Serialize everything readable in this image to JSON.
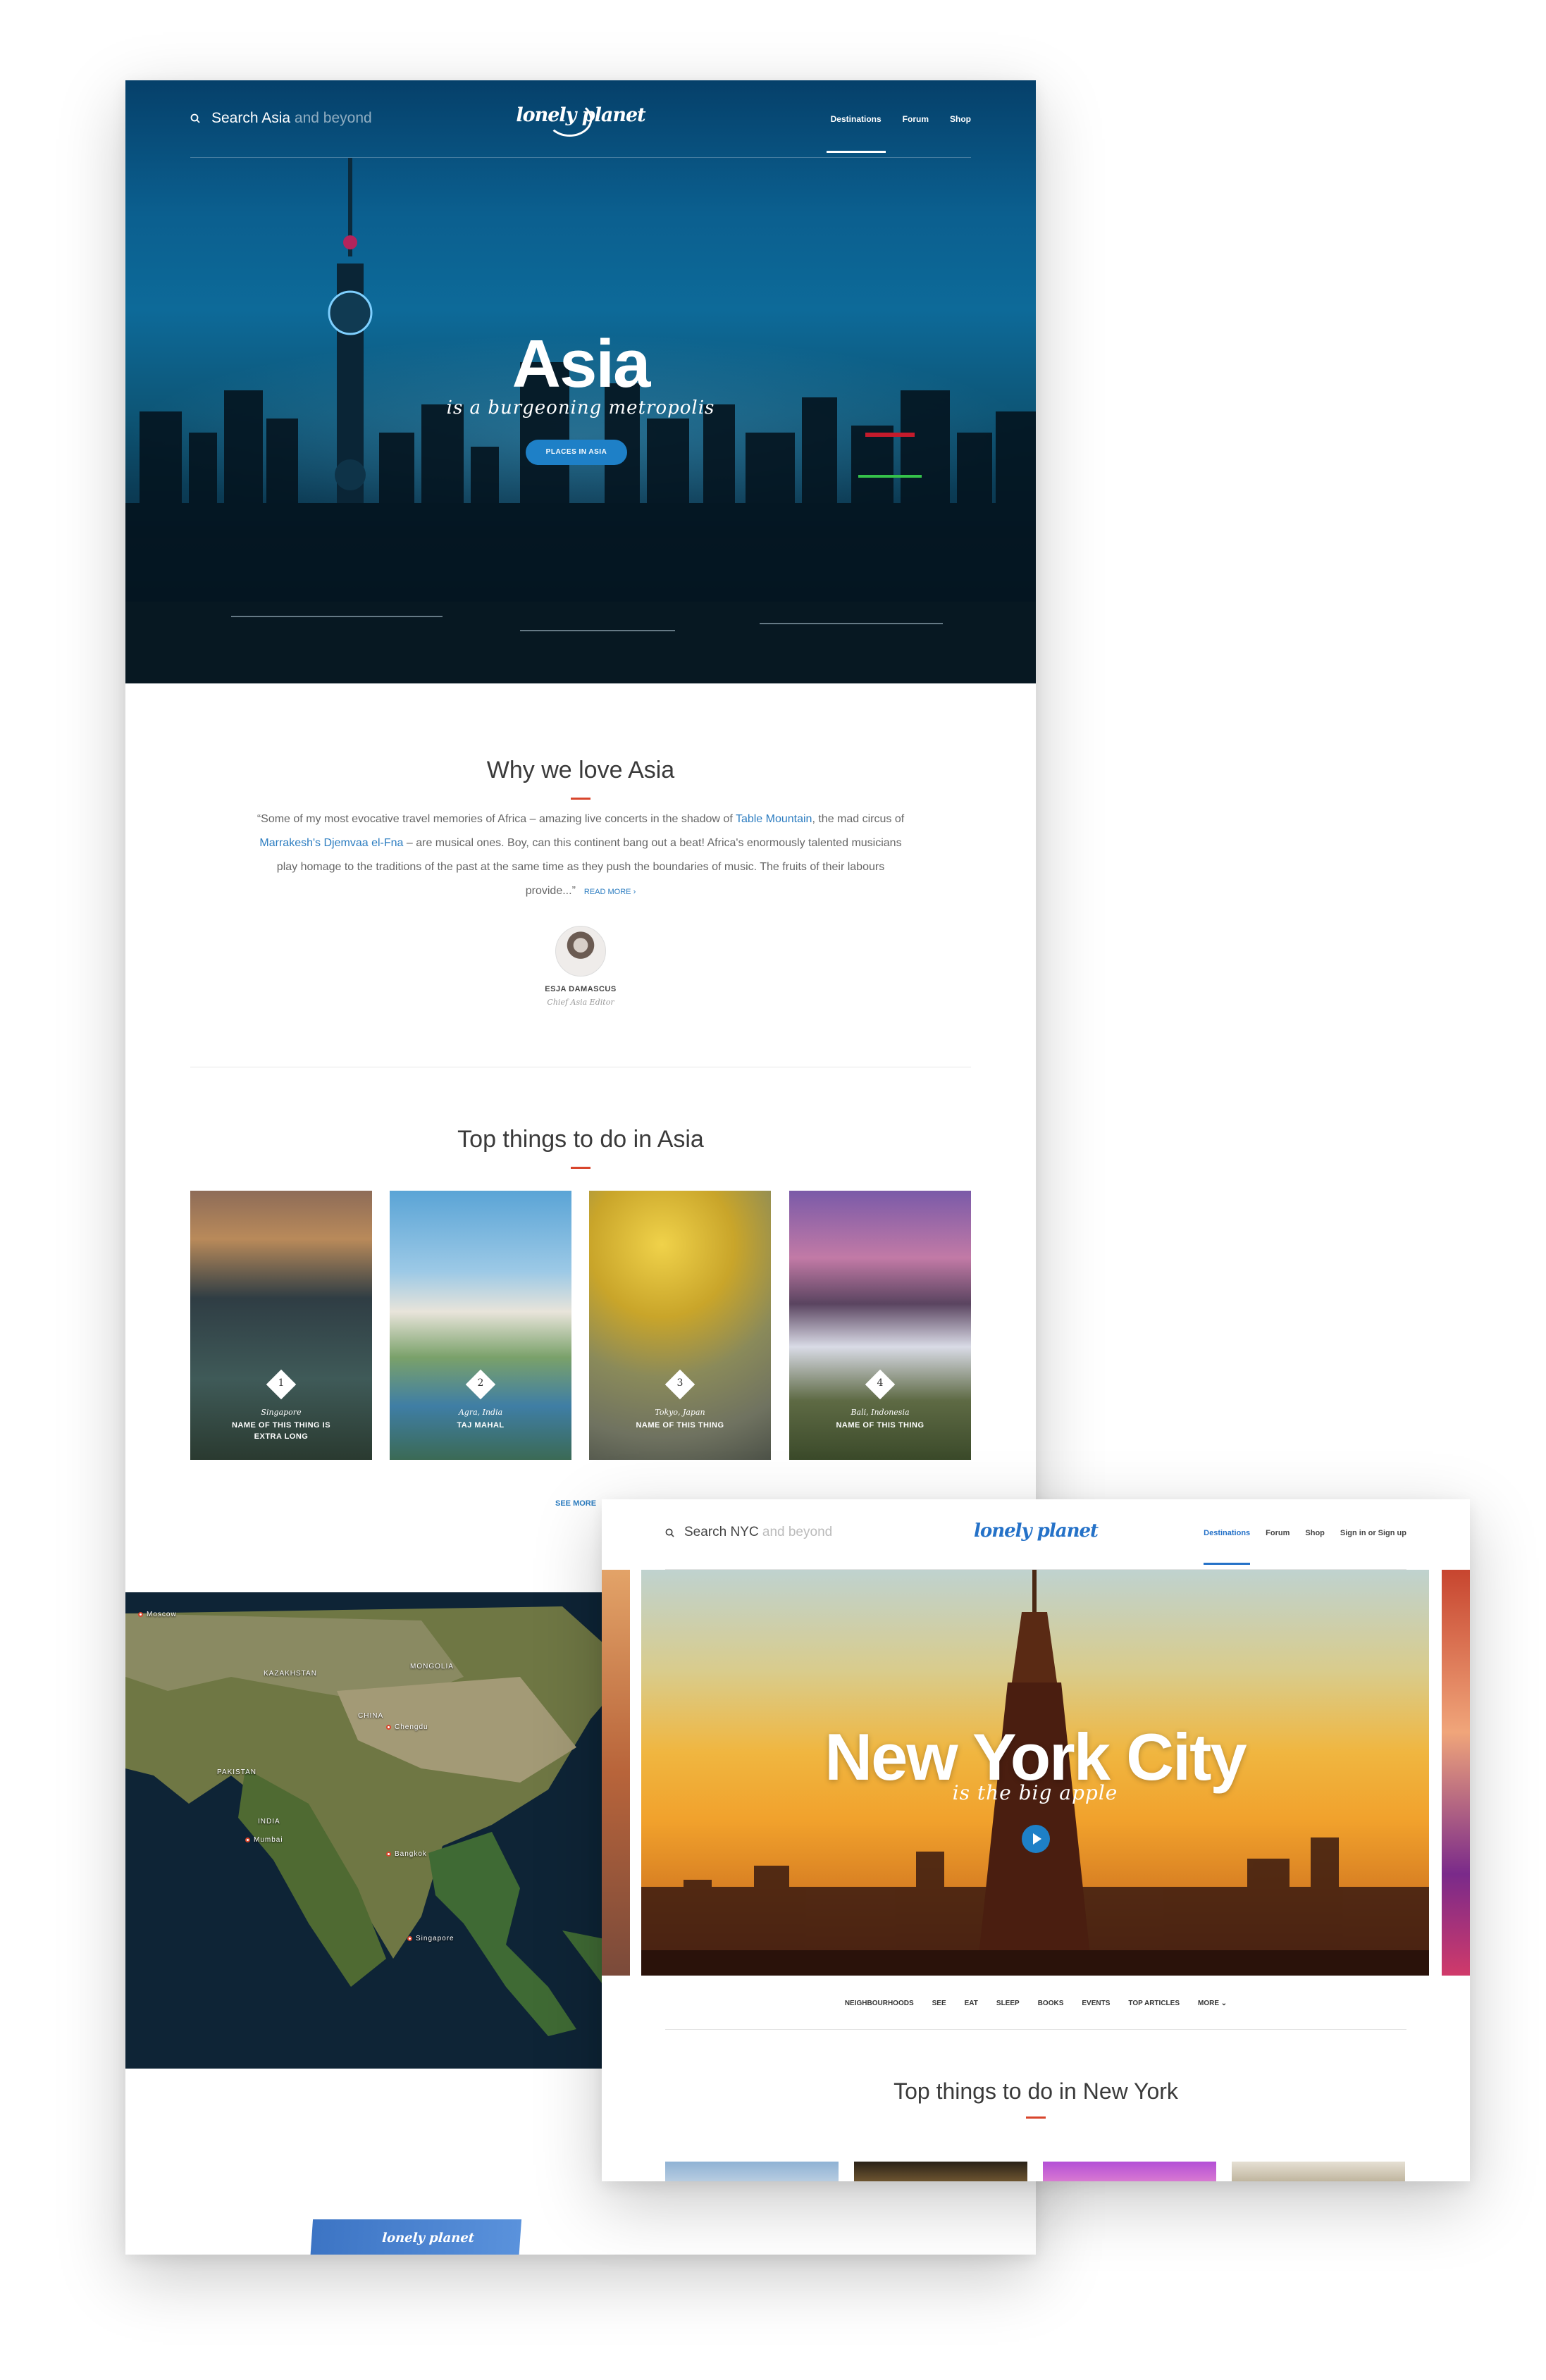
{
  "asia": {
    "nav": {
      "search_text": "Search Asia",
      "search_placeholder": "and beyond",
      "logo": "lonely planet",
      "links": [
        "Destinations",
        "Forum",
        "Shop"
      ]
    },
    "hero": {
      "title": "Asia",
      "subtitle": "is a burgeoning metropolis",
      "button": "PLACES IN ASIA"
    },
    "why": {
      "title": "Why we love Asia",
      "quote_parts": [
        "“Some of my most evocative travel memories of Africa – amazing live concerts in the shadow of ",
        "Table Mountain",
        ", the mad circus of ",
        "Marrakesh's Djemvaa el-Fna",
        " – are musical ones. Boy, can this continent bang out a beat! Africa's enormously talented musicians play homage to the traditions of the past at the same time  as they push the boundaries of music. The fruits of their labours provide...”"
      ],
      "read_more": "READ MORE ›",
      "author_name": "ESJA DAMASCUS",
      "author_role": "Chief Asia Editor"
    },
    "top": {
      "title": "Top things to do in Asia",
      "cards": [
        {
          "num": "1",
          "loc": "Singapore",
          "name": "NAME OF THIS THING IS EXTRA LONG"
        },
        {
          "num": "2",
          "loc": "Agra, India",
          "name": "TAJ MAHAL"
        },
        {
          "num": "3",
          "loc": "Tokyo, Japan",
          "name": "NAME OF THIS THING"
        },
        {
          "num": "4",
          "loc": "Bali, Indonesia",
          "name": "NAME OF THIS THING"
        }
      ],
      "see_more": "SEE MORE"
    },
    "map_labels": [
      "KAZAKHSTAN",
      "MONGOLIA",
      "CHINA",
      "PAKISTAN",
      "INDIA",
      "Chengdu",
      "Mumbai",
      "Bangkok",
      "Singapore",
      "Moscow"
    ],
    "book_logo": "lonely planet"
  },
  "nyc": {
    "nav": {
      "search_text": "Search NYC",
      "search_placeholder": "and beyond",
      "logo": "lonely planet",
      "links": [
        "Destinations",
        "Forum",
        "Shop",
        "Sign in or Sign up"
      ]
    },
    "hero": {
      "title": "New York City",
      "subtitle": "is the big apple"
    },
    "subnav": [
      "NEIGHBOURHOODS",
      "SEE",
      "EAT",
      "SLEEP",
      "BOOKS",
      "EVENTS",
      "TOP ARTICLES",
      "MORE ⌄"
    ],
    "top_title": "Top things to do in New York"
  },
  "colors": {
    "accent": "#1e80c7",
    "brand_blue": "#2572c8",
    "red_rule": "#d8452c",
    "link": "#2b7cc0"
  },
  "icons": [
    "search-icon",
    "play-icon",
    "chevron-right-icon",
    "chevron-down-icon",
    "map-pin-icon"
  ]
}
